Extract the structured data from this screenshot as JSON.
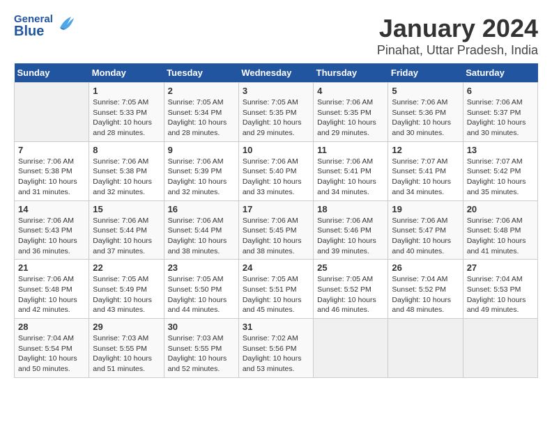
{
  "header": {
    "logo_general": "General",
    "logo_blue": "Blue",
    "title": "January 2024",
    "subtitle": "Pinahat, Uttar Pradesh, India"
  },
  "days_of_week": [
    "Sunday",
    "Monday",
    "Tuesday",
    "Wednesday",
    "Thursday",
    "Friday",
    "Saturday"
  ],
  "weeks": [
    [
      {
        "day": "",
        "empty": true
      },
      {
        "day": "1",
        "sunrise": "Sunrise: 7:05 AM",
        "sunset": "Sunset: 5:33 PM",
        "daylight": "Daylight: 10 hours and 28 minutes."
      },
      {
        "day": "2",
        "sunrise": "Sunrise: 7:05 AM",
        "sunset": "Sunset: 5:34 PM",
        "daylight": "Daylight: 10 hours and 28 minutes."
      },
      {
        "day": "3",
        "sunrise": "Sunrise: 7:05 AM",
        "sunset": "Sunset: 5:35 PM",
        "daylight": "Daylight: 10 hours and 29 minutes."
      },
      {
        "day": "4",
        "sunrise": "Sunrise: 7:06 AM",
        "sunset": "Sunset: 5:35 PM",
        "daylight": "Daylight: 10 hours and 29 minutes."
      },
      {
        "day": "5",
        "sunrise": "Sunrise: 7:06 AM",
        "sunset": "Sunset: 5:36 PM",
        "daylight": "Daylight: 10 hours and 30 minutes."
      },
      {
        "day": "6",
        "sunrise": "Sunrise: 7:06 AM",
        "sunset": "Sunset: 5:37 PM",
        "daylight": "Daylight: 10 hours and 30 minutes."
      }
    ],
    [
      {
        "day": "7",
        "sunrise": "Sunrise: 7:06 AM",
        "sunset": "Sunset: 5:38 PM",
        "daylight": "Daylight: 10 hours and 31 minutes."
      },
      {
        "day": "8",
        "sunrise": "Sunrise: 7:06 AM",
        "sunset": "Sunset: 5:38 PM",
        "daylight": "Daylight: 10 hours and 32 minutes."
      },
      {
        "day": "9",
        "sunrise": "Sunrise: 7:06 AM",
        "sunset": "Sunset: 5:39 PM",
        "daylight": "Daylight: 10 hours and 32 minutes."
      },
      {
        "day": "10",
        "sunrise": "Sunrise: 7:06 AM",
        "sunset": "Sunset: 5:40 PM",
        "daylight": "Daylight: 10 hours and 33 minutes."
      },
      {
        "day": "11",
        "sunrise": "Sunrise: 7:06 AM",
        "sunset": "Sunset: 5:41 PM",
        "daylight": "Daylight: 10 hours and 34 minutes."
      },
      {
        "day": "12",
        "sunrise": "Sunrise: 7:07 AM",
        "sunset": "Sunset: 5:41 PM",
        "daylight": "Daylight: 10 hours and 34 minutes."
      },
      {
        "day": "13",
        "sunrise": "Sunrise: 7:07 AM",
        "sunset": "Sunset: 5:42 PM",
        "daylight": "Daylight: 10 hours and 35 minutes."
      }
    ],
    [
      {
        "day": "14",
        "sunrise": "Sunrise: 7:06 AM",
        "sunset": "Sunset: 5:43 PM",
        "daylight": "Daylight: 10 hours and 36 minutes."
      },
      {
        "day": "15",
        "sunrise": "Sunrise: 7:06 AM",
        "sunset": "Sunset: 5:44 PM",
        "daylight": "Daylight: 10 hours and 37 minutes."
      },
      {
        "day": "16",
        "sunrise": "Sunrise: 7:06 AM",
        "sunset": "Sunset: 5:44 PM",
        "daylight": "Daylight: 10 hours and 38 minutes."
      },
      {
        "day": "17",
        "sunrise": "Sunrise: 7:06 AM",
        "sunset": "Sunset: 5:45 PM",
        "daylight": "Daylight: 10 hours and 38 minutes."
      },
      {
        "day": "18",
        "sunrise": "Sunrise: 7:06 AM",
        "sunset": "Sunset: 5:46 PM",
        "daylight": "Daylight: 10 hours and 39 minutes."
      },
      {
        "day": "19",
        "sunrise": "Sunrise: 7:06 AM",
        "sunset": "Sunset: 5:47 PM",
        "daylight": "Daylight: 10 hours and 40 minutes."
      },
      {
        "day": "20",
        "sunrise": "Sunrise: 7:06 AM",
        "sunset": "Sunset: 5:48 PM",
        "daylight": "Daylight: 10 hours and 41 minutes."
      }
    ],
    [
      {
        "day": "21",
        "sunrise": "Sunrise: 7:06 AM",
        "sunset": "Sunset: 5:48 PM",
        "daylight": "Daylight: 10 hours and 42 minutes."
      },
      {
        "day": "22",
        "sunrise": "Sunrise: 7:05 AM",
        "sunset": "Sunset: 5:49 PM",
        "daylight": "Daylight: 10 hours and 43 minutes."
      },
      {
        "day": "23",
        "sunrise": "Sunrise: 7:05 AM",
        "sunset": "Sunset: 5:50 PM",
        "daylight": "Daylight: 10 hours and 44 minutes."
      },
      {
        "day": "24",
        "sunrise": "Sunrise: 7:05 AM",
        "sunset": "Sunset: 5:51 PM",
        "daylight": "Daylight: 10 hours and 45 minutes."
      },
      {
        "day": "25",
        "sunrise": "Sunrise: 7:05 AM",
        "sunset": "Sunset: 5:52 PM",
        "daylight": "Daylight: 10 hours and 46 minutes."
      },
      {
        "day": "26",
        "sunrise": "Sunrise: 7:04 AM",
        "sunset": "Sunset: 5:52 PM",
        "daylight": "Daylight: 10 hours and 48 minutes."
      },
      {
        "day": "27",
        "sunrise": "Sunrise: 7:04 AM",
        "sunset": "Sunset: 5:53 PM",
        "daylight": "Daylight: 10 hours and 49 minutes."
      }
    ],
    [
      {
        "day": "28",
        "sunrise": "Sunrise: 7:04 AM",
        "sunset": "Sunset: 5:54 PM",
        "daylight": "Daylight: 10 hours and 50 minutes."
      },
      {
        "day": "29",
        "sunrise": "Sunrise: 7:03 AM",
        "sunset": "Sunset: 5:55 PM",
        "daylight": "Daylight: 10 hours and 51 minutes."
      },
      {
        "day": "30",
        "sunrise": "Sunrise: 7:03 AM",
        "sunset": "Sunset: 5:55 PM",
        "daylight": "Daylight: 10 hours and 52 minutes."
      },
      {
        "day": "31",
        "sunrise": "Sunrise: 7:02 AM",
        "sunset": "Sunset: 5:56 PM",
        "daylight": "Daylight: 10 hours and 53 minutes."
      },
      {
        "day": "",
        "empty": true
      },
      {
        "day": "",
        "empty": true
      },
      {
        "day": "",
        "empty": true
      }
    ]
  ]
}
